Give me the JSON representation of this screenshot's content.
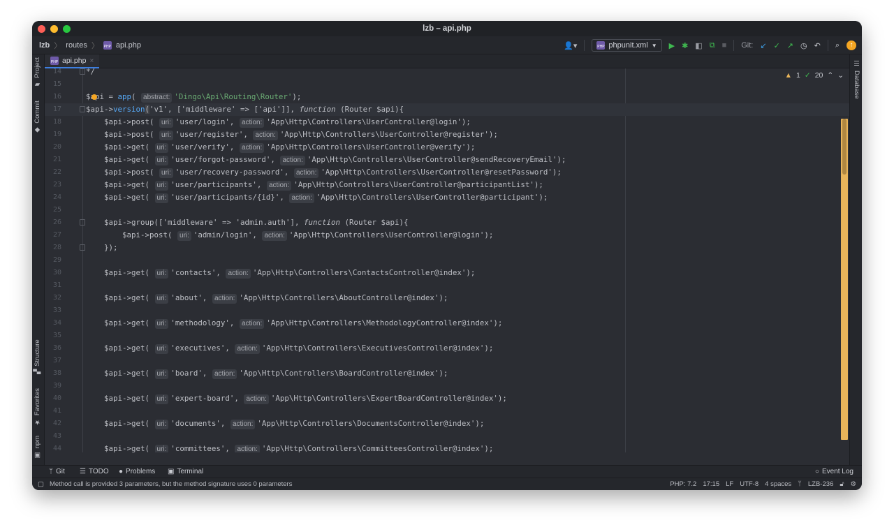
{
  "window": {
    "title": "lzb – api.php"
  },
  "breadcrumb": [
    "lzb",
    "routes",
    "api.php"
  ],
  "toolbar": {
    "run_config": "phpunit.xml",
    "git_label": "Git:"
  },
  "tab": {
    "label": "api.php"
  },
  "left_tools": [
    "Project",
    "Commit",
    "Structure",
    "Favorites",
    "npm"
  ],
  "right_tools": [
    "Database"
  ],
  "inspections": {
    "warnings": "1",
    "checks": "20"
  },
  "code": [
    {
      "n": "14",
      "segs": [
        [
          "*/",
          "var"
        ]
      ]
    },
    {
      "n": "15",
      "segs": []
    },
    {
      "n": "16",
      "segs": [
        [
          "$api = ",
          "var"
        ],
        [
          "app",
          "fn"
        ],
        [
          "( ",
          "var"
        ],
        [
          "abstract:",
          "hint"
        ],
        [
          "'Dingo\\Api\\Routing\\Router'",
          "str"
        ],
        [
          ");",
          "var"
        ]
      ]
    },
    {
      "n": "17",
      "segs": [
        [
          "$api->",
          "var"
        ],
        [
          "version",
          "fn"
        ],
        [
          "(",
          "brace"
        ],
        [
          "'v1', ['middleware' => ['api']], ",
          "var"
        ],
        [
          "function",
          "kw"
        ],
        [
          " (Router $api){",
          "var"
        ]
      ]
    },
    {
      "n": "18",
      "i": 1,
      "segs": [
        [
          "$api->post( ",
          "var"
        ],
        [
          "uri:",
          "hint"
        ],
        [
          "'user/login', ",
          "var"
        ],
        [
          "action:",
          "hint"
        ],
        [
          "'App\\Http\\Controllers\\UserController@login');",
          "var"
        ]
      ]
    },
    {
      "n": "19",
      "i": 1,
      "segs": [
        [
          "$api->post( ",
          "var"
        ],
        [
          "uri:",
          "hint"
        ],
        [
          "'user/register', ",
          "var"
        ],
        [
          "action:",
          "hint"
        ],
        [
          "'App\\Http\\Controllers\\UserController@register');",
          "var"
        ]
      ]
    },
    {
      "n": "20",
      "i": 1,
      "segs": [
        [
          "$api->get( ",
          "var"
        ],
        [
          "uri:",
          "hint"
        ],
        [
          "'user/verify', ",
          "var"
        ],
        [
          "action:",
          "hint"
        ],
        [
          "'App\\Http\\Controllers\\UserController@verify');",
          "var"
        ]
      ]
    },
    {
      "n": "21",
      "i": 1,
      "segs": [
        [
          "$api->get( ",
          "var"
        ],
        [
          "uri:",
          "hint"
        ],
        [
          "'user/forgot-password', ",
          "var"
        ],
        [
          "action:",
          "hint"
        ],
        [
          "'App\\Http\\Controllers\\UserController@sendRecoveryEmail');",
          "var"
        ]
      ]
    },
    {
      "n": "22",
      "i": 1,
      "segs": [
        [
          "$api->post( ",
          "var"
        ],
        [
          "uri:",
          "hint"
        ],
        [
          "'user/recovery-password', ",
          "var"
        ],
        [
          "action:",
          "hint"
        ],
        [
          "'App\\Http\\Controllers\\UserController@resetPassword');",
          "var"
        ]
      ]
    },
    {
      "n": "23",
      "i": 1,
      "segs": [
        [
          "$api->get( ",
          "var"
        ],
        [
          "uri:",
          "hint"
        ],
        [
          "'user/participants', ",
          "var"
        ],
        [
          "action:",
          "hint"
        ],
        [
          "'App\\Http\\Controllers\\UserController@participantList');",
          "var"
        ]
      ]
    },
    {
      "n": "24",
      "i": 1,
      "segs": [
        [
          "$api->get( ",
          "var"
        ],
        [
          "uri:",
          "hint"
        ],
        [
          "'user/participants/{id}', ",
          "var"
        ],
        [
          "action:",
          "hint"
        ],
        [
          "'App\\Http\\Controllers\\UserController@participant');",
          "var"
        ]
      ]
    },
    {
      "n": "25",
      "segs": []
    },
    {
      "n": "26",
      "i": 1,
      "segs": [
        [
          "$api->group(['middleware' => 'admin.auth'], ",
          "var"
        ],
        [
          "function",
          "kw"
        ],
        [
          " (Router $api){",
          "var"
        ]
      ]
    },
    {
      "n": "27",
      "i": 2,
      "segs": [
        [
          "$api->post( ",
          "var"
        ],
        [
          "uri:",
          "hint"
        ],
        [
          "'admin/login', ",
          "var"
        ],
        [
          "action:",
          "hint"
        ],
        [
          "'App\\Http\\Controllers\\UserController@login');",
          "var"
        ]
      ]
    },
    {
      "n": "28",
      "i": 1,
      "segs": [
        [
          "});",
          "var"
        ]
      ]
    },
    {
      "n": "29",
      "segs": []
    },
    {
      "n": "30",
      "i": 1,
      "segs": [
        [
          "$api->get( ",
          "var"
        ],
        [
          "uri:",
          "hint"
        ],
        [
          "'contacts', ",
          "var"
        ],
        [
          "action:",
          "hint"
        ],
        [
          "'App\\Http\\Controllers\\ContactsController@index');",
          "var"
        ]
      ]
    },
    {
      "n": "31",
      "segs": []
    },
    {
      "n": "32",
      "i": 1,
      "segs": [
        [
          "$api->get( ",
          "var"
        ],
        [
          "uri:",
          "hint"
        ],
        [
          "'about', ",
          "var"
        ],
        [
          "action:",
          "hint"
        ],
        [
          "'App\\Http\\Controllers\\AboutController@index');",
          "var"
        ]
      ]
    },
    {
      "n": "33",
      "segs": []
    },
    {
      "n": "34",
      "i": 1,
      "segs": [
        [
          "$api->get( ",
          "var"
        ],
        [
          "uri:",
          "hint"
        ],
        [
          "'methodology', ",
          "var"
        ],
        [
          "action:",
          "hint"
        ],
        [
          "'App\\Http\\Controllers\\MethodologyController@index');",
          "var"
        ]
      ]
    },
    {
      "n": "35",
      "segs": []
    },
    {
      "n": "36",
      "i": 1,
      "segs": [
        [
          "$api->get( ",
          "var"
        ],
        [
          "uri:",
          "hint"
        ],
        [
          "'executives', ",
          "var"
        ],
        [
          "action:",
          "hint"
        ],
        [
          "'App\\Http\\Controllers\\ExecutivesController@index');",
          "var"
        ]
      ]
    },
    {
      "n": "37",
      "segs": []
    },
    {
      "n": "38",
      "i": 1,
      "segs": [
        [
          "$api->get( ",
          "var"
        ],
        [
          "uri:",
          "hint"
        ],
        [
          "'board', ",
          "var"
        ],
        [
          "action:",
          "hint"
        ],
        [
          "'App\\Http\\Controllers\\BoardController@index');",
          "var"
        ]
      ]
    },
    {
      "n": "39",
      "segs": []
    },
    {
      "n": "40",
      "i": 1,
      "segs": [
        [
          "$api->get( ",
          "var"
        ],
        [
          "uri:",
          "hint"
        ],
        [
          "'expert-board', ",
          "var"
        ],
        [
          "action:",
          "hint"
        ],
        [
          "'App\\Http\\Controllers\\ExpertBoardController@index');",
          "var"
        ]
      ]
    },
    {
      "n": "41",
      "segs": []
    },
    {
      "n": "42",
      "i": 1,
      "segs": [
        [
          "$api->get( ",
          "var"
        ],
        [
          "uri:",
          "hint"
        ],
        [
          "'documents', ",
          "var"
        ],
        [
          "action:",
          "hint"
        ],
        [
          "'App\\Http\\Controllers\\DocumentsController@index');",
          "var"
        ]
      ]
    },
    {
      "n": "43",
      "segs": []
    },
    {
      "n": "44",
      "i": 1,
      "segs": [
        [
          "$api->get( ",
          "var"
        ],
        [
          "uri:",
          "hint"
        ],
        [
          "'committees', ",
          "var"
        ],
        [
          "action:",
          "hint"
        ],
        [
          "'App\\Http\\Controllers\\CommitteesController@index');",
          "var"
        ]
      ]
    }
  ],
  "current_line": "17",
  "bottom_tools": [
    "Git",
    "TODO",
    "Problems",
    "Terminal"
  ],
  "event_log": "Event Log",
  "status": {
    "message": "Method call is provided 3 parameters, but the method signature uses 0 parameters",
    "php": "PHP: 7.2",
    "position": "17:15",
    "line_sep": "LF",
    "encoding": "UTF-8",
    "indent": "4 spaces",
    "branch": "LZB-236"
  },
  "colors": {
    "accent": "#3d7fe0",
    "scrollbar_marker": "#e8b45a",
    "string": "#6aab73",
    "function": "#56a8f5"
  }
}
